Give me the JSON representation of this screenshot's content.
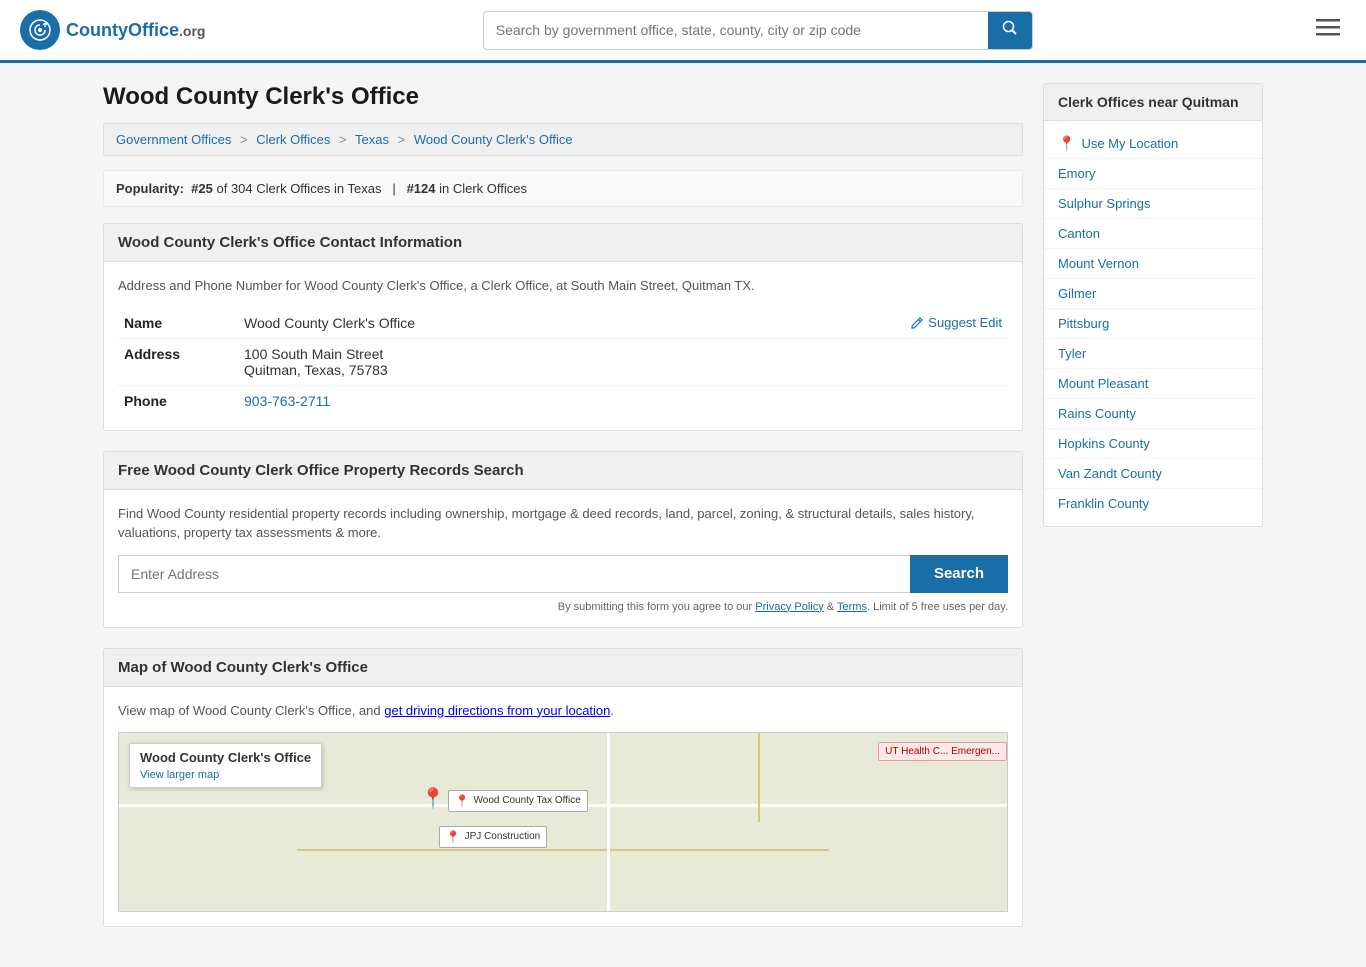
{
  "header": {
    "logo_text": "CountyOffice",
    "logo_suffix": ".org",
    "search_placeholder": "Search by government office, state, county, city or zip code"
  },
  "page": {
    "title": "Wood County Clerk's Office"
  },
  "breadcrumb": {
    "items": [
      {
        "label": "Government Offices",
        "href": "#"
      },
      {
        "label": "Clerk Offices",
        "href": "#"
      },
      {
        "label": "Texas",
        "href": "#"
      },
      {
        "label": "Wood County Clerk's Office",
        "href": "#"
      }
    ]
  },
  "popularity": {
    "rank": "#25",
    "total": "304",
    "state": "Texas",
    "national_rank": "#124",
    "category": "Clerk Offices"
  },
  "contact_section": {
    "heading": "Wood County Clerk's Office Contact Information",
    "description": "Address and Phone Number for Wood County Clerk's Office, a Clerk Office, at South Main Street, Quitman TX.",
    "name_label": "Name",
    "name_value": "Wood County Clerk's Office",
    "address_label": "Address",
    "address_line1": "100 South Main Street",
    "address_line2": "Quitman, Texas, 75783",
    "phone_label": "Phone",
    "phone_value": "903-763-2711",
    "suggest_edit": "Suggest Edit"
  },
  "property_section": {
    "heading": "Free Wood County Clerk Office Property Records Search",
    "description": "Find Wood County residential property records including ownership, mortgage & deed records, land, parcel, zoning, & structural details, sales history, valuations, property tax assessments & more.",
    "input_placeholder": "Enter Address",
    "search_btn": "Search",
    "disclaimer": "By submitting this form you agree to our",
    "privacy_policy": "Privacy Policy",
    "terms": "Terms",
    "limit": "Limit of 5 free uses per day."
  },
  "map_section": {
    "heading": "Map of Wood County Clerk's Office",
    "description": "View map of Wood County Clerk's Office, and",
    "directions_link": "get driving directions from your location",
    "overlay_title": "Wood County Clerk's Office",
    "overlay_link": "View larger map",
    "map_label_tax": "Wood County Tax Office",
    "map_label_jpj": "JPJ Construction",
    "map_label_ut": "UT Health C... Emergen..."
  },
  "sidebar": {
    "title": "Clerk Offices near Quitman",
    "use_location": "Use My Location",
    "links": [
      "Emory",
      "Sulphur Springs",
      "Canton",
      "Mount Vernon",
      "Gilmer",
      "Pittsburg",
      "Tyler",
      "Mount Pleasant",
      "Rains County",
      "Hopkins County",
      "Van Zandt County",
      "Franklin County"
    ]
  }
}
